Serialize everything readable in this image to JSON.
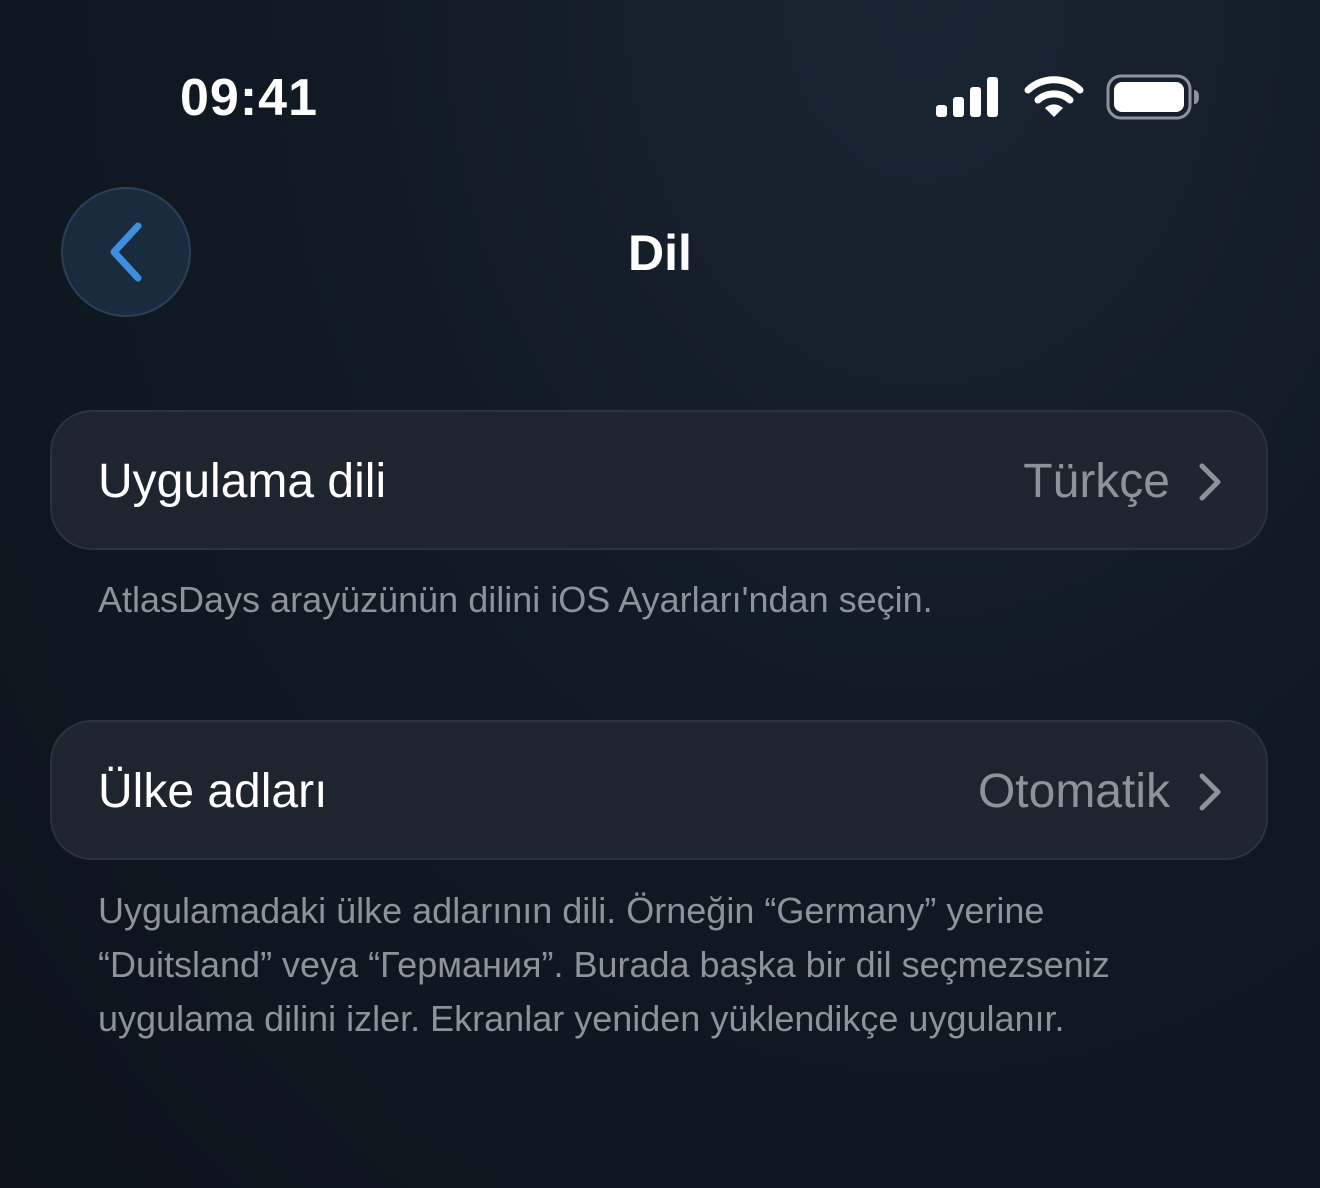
{
  "status_bar": {
    "time": "09:41",
    "icons": [
      "cellular-signal-icon",
      "wifi-icon",
      "battery-icon"
    ]
  },
  "nav": {
    "title": "Dil",
    "back_icon": "chevron-left-icon"
  },
  "settings": [
    {
      "label": "Uygulama dili",
      "value": "Türkçe",
      "chevron": "chevron-right-icon",
      "footnote": "AtlasDays arayüzünün dilini iOS Ayarları'ndan seçin."
    },
    {
      "label": "Ülke adları",
      "value": "Otomatik",
      "chevron": "chevron-right-icon",
      "footnote": "Uygulamadaki ülke adlarının dili. Örneğin “Germany” yerine “Duitsland” veya “Германия”. Burada başka bir dil seçmezseniz uygulama dilini izler. Ekranlar yeniden yüklendikçe uygulanır."
    }
  ],
  "colors": {
    "accent": "#3e8ede",
    "background": "#111a24",
    "cell": "#1f252e",
    "secondary_text": "#8e9399"
  }
}
